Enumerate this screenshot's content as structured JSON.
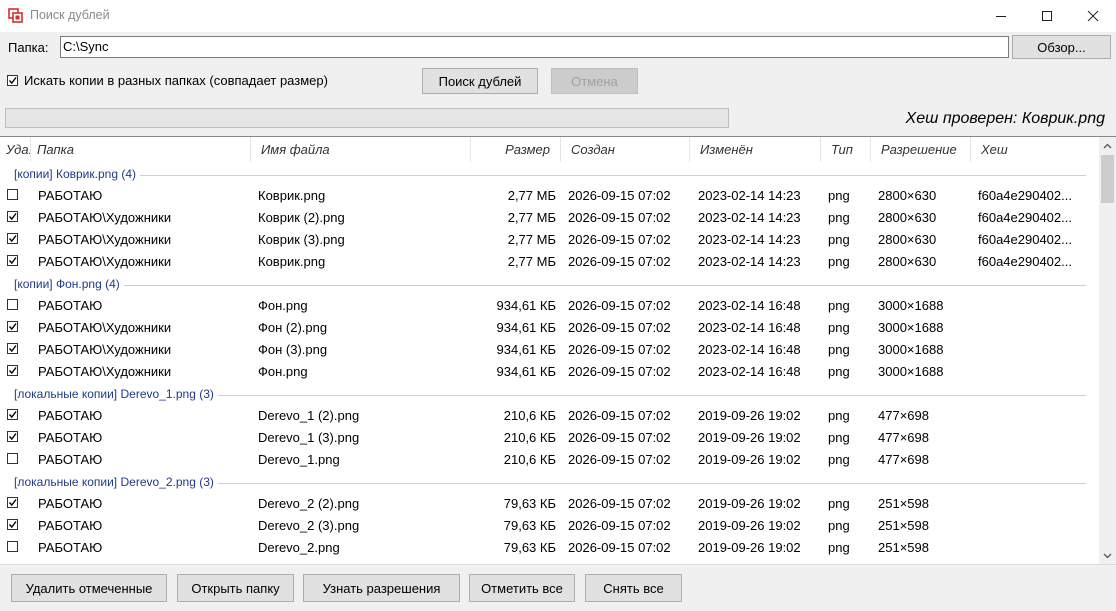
{
  "window": {
    "title": "Поиск дублей",
    "controls": [
      "minimize",
      "maximize",
      "close"
    ]
  },
  "folder": {
    "label": "Папка:",
    "value": "C:\\Sync",
    "browse_label": "Обзор..."
  },
  "options": {
    "cross_folder_checked": true,
    "cross_folder_label": "Искать копии в разных папках (совпадает размер)",
    "search_label": "Поиск дублей",
    "cancel_label": "Отмена"
  },
  "status": {
    "hash_checked": "Хеш проверен: Коврик.png"
  },
  "table": {
    "columns": [
      "Уда...",
      "Папка",
      "Имя файла",
      "Размер",
      "Создан",
      "Изменён",
      "Тип",
      "Разрешение",
      "Хеш"
    ],
    "groups": [
      {
        "label": "[копии] Коврик.png (4)",
        "rows": [
          {
            "checked": false,
            "folder": "РАБОТАЮ",
            "name": "Коврик.png",
            "size": "2,77 МБ",
            "created": "2026-09-15 07:02",
            "modified": "2023-02-14 14:23",
            "type": "png",
            "resolution": "2800×630",
            "hash": "f60a4e290402..."
          },
          {
            "checked": true,
            "folder": "РАБОТАЮ\\Художники",
            "name": "Коврик (2).png",
            "size": "2,77 МБ",
            "created": "2026-09-15 07:02",
            "modified": "2023-02-14 14:23",
            "type": "png",
            "resolution": "2800×630",
            "hash": "f60a4e290402..."
          },
          {
            "checked": true,
            "folder": "РАБОТАЮ\\Художники",
            "name": "Коврик (3).png",
            "size": "2,77 МБ",
            "created": "2026-09-15 07:02",
            "modified": "2023-02-14 14:23",
            "type": "png",
            "resolution": "2800×630",
            "hash": "f60a4e290402..."
          },
          {
            "checked": true,
            "folder": "РАБОТАЮ\\Художники",
            "name": "Коврик.png",
            "size": "2,77 МБ",
            "created": "2026-09-15 07:02",
            "modified": "2023-02-14 14:23",
            "type": "png",
            "resolution": "2800×630",
            "hash": "f60a4e290402..."
          }
        ]
      },
      {
        "label": "[копии] Фон.png (4)",
        "rows": [
          {
            "checked": false,
            "folder": "РАБОТАЮ",
            "name": "Фон.png",
            "size": "934,61 КБ",
            "created": "2026-09-15 07:02",
            "modified": "2023-02-14 16:48",
            "type": "png",
            "resolution": "3000×1688",
            "hash": ""
          },
          {
            "checked": true,
            "folder": "РАБОТАЮ\\Художники",
            "name": "Фон (2).png",
            "size": "934,61 КБ",
            "created": "2026-09-15 07:02",
            "modified": "2023-02-14 16:48",
            "type": "png",
            "resolution": "3000×1688",
            "hash": ""
          },
          {
            "checked": true,
            "folder": "РАБОТАЮ\\Художники",
            "name": "Фон (3).png",
            "size": "934,61 КБ",
            "created": "2026-09-15 07:02",
            "modified": "2023-02-14 16:48",
            "type": "png",
            "resolution": "3000×1688",
            "hash": ""
          },
          {
            "checked": true,
            "folder": "РАБОТАЮ\\Художники",
            "name": "Фон.png",
            "size": "934,61 КБ",
            "created": "2026-09-15 07:02",
            "modified": "2023-02-14 16:48",
            "type": "png",
            "resolution": "3000×1688",
            "hash": ""
          }
        ]
      },
      {
        "label": "[локальные копии] Derevo_1.png (3)",
        "rows": [
          {
            "checked": true,
            "folder": "РАБОТАЮ",
            "name": "Derevo_1 (2).png",
            "size": "210,6 КБ",
            "created": "2026-09-15 07:02",
            "modified": "2019-09-26 19:02",
            "type": "png",
            "resolution": "477×698",
            "hash": ""
          },
          {
            "checked": true,
            "folder": "РАБОТАЮ",
            "name": "Derevo_1 (3).png",
            "size": "210,6 КБ",
            "created": "2026-09-15 07:02",
            "modified": "2019-09-26 19:02",
            "type": "png",
            "resolution": "477×698",
            "hash": ""
          },
          {
            "checked": false,
            "folder": "РАБОТАЮ",
            "name": "Derevo_1.png",
            "size": "210,6 КБ",
            "created": "2026-09-15 07:02",
            "modified": "2019-09-26 19:02",
            "type": "png",
            "resolution": "477×698",
            "hash": ""
          }
        ]
      },
      {
        "label": "[локальные копии] Derevo_2.png (3)",
        "rows": [
          {
            "checked": true,
            "folder": "РАБОТАЮ",
            "name": "Derevo_2 (2).png",
            "size": "79,63 КБ",
            "created": "2026-09-15 07:02",
            "modified": "2019-09-26 19:02",
            "type": "png",
            "resolution": "251×598",
            "hash": ""
          },
          {
            "checked": true,
            "folder": "РАБОТАЮ",
            "name": "Derevo_2 (3).png",
            "size": "79,63 КБ",
            "created": "2026-09-15 07:02",
            "modified": "2019-09-26 19:02",
            "type": "png",
            "resolution": "251×598",
            "hash": ""
          },
          {
            "checked": false,
            "folder": "РАБОТАЮ",
            "name": "Derevo_2.png",
            "size": "79,63 КБ",
            "created": "2026-09-15 07:02",
            "modified": "2019-09-26 19:02",
            "type": "png",
            "resolution": "251×598",
            "hash": ""
          }
        ]
      }
    ]
  },
  "actions": {
    "delete_marked": "Удалить отмеченные",
    "open_folder": "Открыть папку",
    "get_resolutions": "Узнать разрешения",
    "check_all": "Отметить все",
    "uncheck_all": "Снять все"
  },
  "colors": {
    "group_label": "#1e3a8a",
    "app_icon": "#d32f2f"
  }
}
